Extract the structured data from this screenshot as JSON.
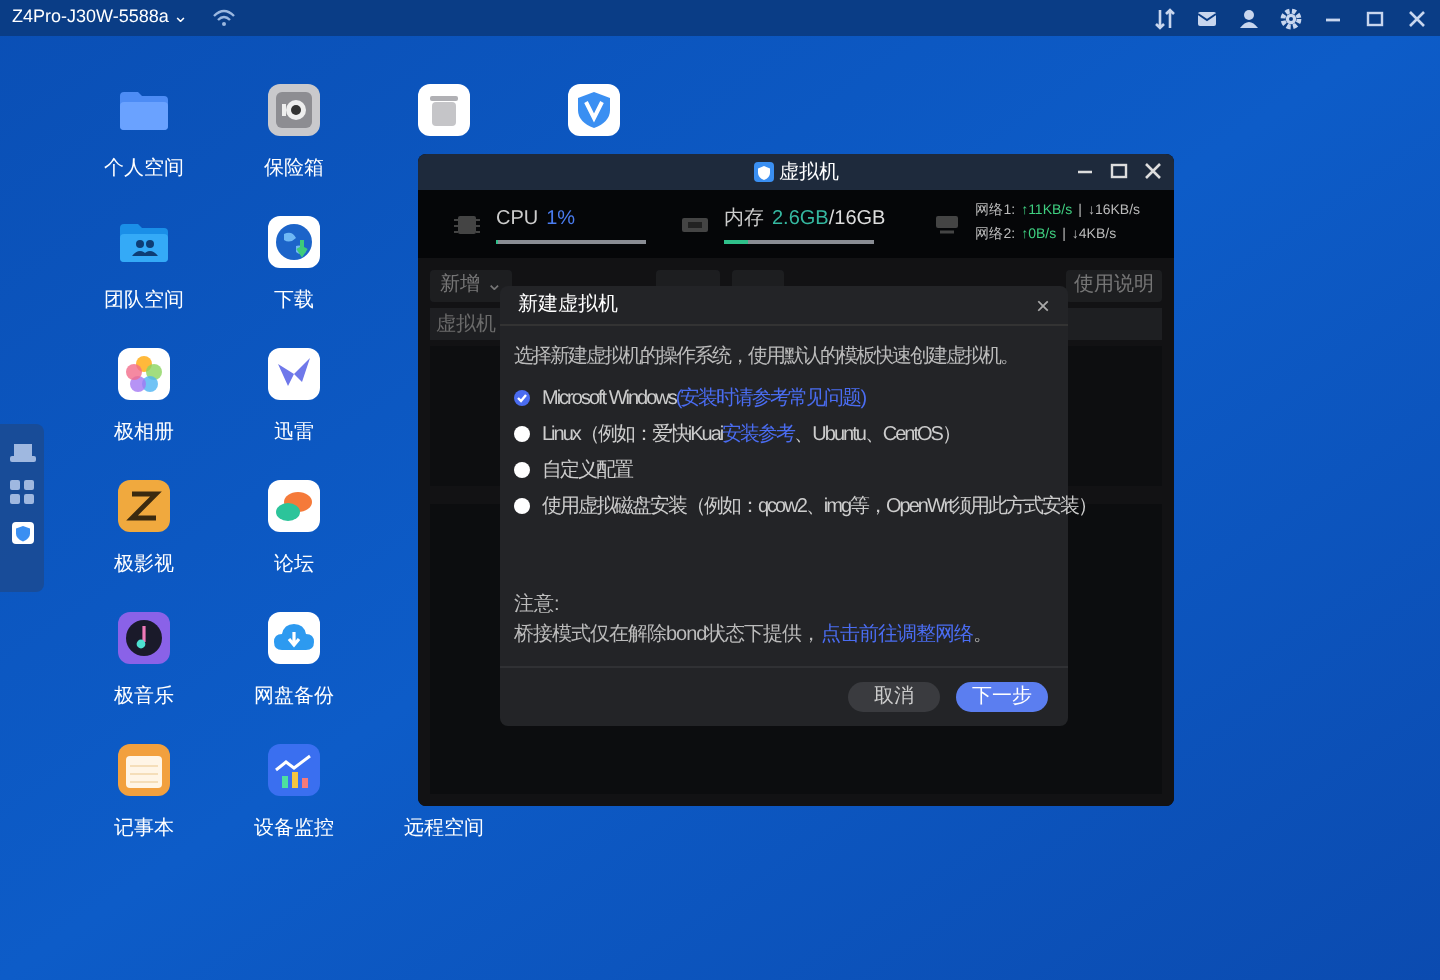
{
  "top_bar": {
    "device": "Z4Pro-J30W-5588a",
    "caret": "⌄"
  },
  "desktop_apps": [
    {
      "kind": "folder",
      "label": "个人空间"
    },
    {
      "kind": "safe",
      "label": "保险箱"
    },
    {
      "kind": "trash"
    },
    {
      "kind": "shield"
    },
    {
      "kind": "team",
      "label": "团队空间"
    },
    {
      "kind": "globe",
      "label": "下载"
    },
    {
      "kind": "photos",
      "label": "极相册"
    },
    {
      "kind": "bird",
      "label": "迅雷"
    },
    {
      "kind": "film",
      "label": "极影视"
    },
    {
      "kind": "chat",
      "label": "论坛"
    },
    {
      "kind": "music",
      "label": "极音乐"
    },
    {
      "kind": "cloud",
      "label": "网盘备份"
    },
    {
      "kind": "notes",
      "label": "记事本"
    },
    {
      "kind": "chart",
      "label": "设备监控"
    },
    {
      "kind": "hidden",
      "label": "远程空间"
    }
  ],
  "window": {
    "title": "虚拟机",
    "cpu": {
      "label": "CPU",
      "value": "1%",
      "level": 0.01
    },
    "memory": {
      "label": "内存",
      "value": "2.6GB",
      "total": "/16GB",
      "level": 0.16
    },
    "network": [
      {
        "label": "网络1:",
        "up": "↑11KB/s",
        "sep": "|",
        "down": "↓16KB/s"
      },
      {
        "label": "网络2:",
        "up": "↑0B/s",
        "sep": "|",
        "down": "↓4KB/s"
      }
    ],
    "toolbar": {
      "add": "新增 ⌄",
      "help": "使用说明"
    },
    "table_header": "虚拟机"
  },
  "dialog": {
    "title": "新建虚拟机",
    "close": "×",
    "description": "选择新建虚拟机的操作系统，使用默认的模板快速创建虚拟机。",
    "options": [
      {
        "text": "Microsoft Windows",
        "link": "(安装时请参考常见问题)",
        "selected": true
      },
      {
        "text": "Linux（例如：爱快iKuai",
        "link": "安装参考",
        "after": "、Ubuntu、CentOS）",
        "selected": false
      },
      {
        "text": "自定义配置",
        "selected": false
      },
      {
        "text": "使用虚拟磁盘安装（例如：qcow2、img等，OpenWrt须用此方式安装）",
        "selected": false
      }
    ],
    "note_title": "注意:",
    "note_text": "桥接模式仅在解除bond状态下提供，",
    "note_link": "点击前往调整网络",
    "note_end": "。",
    "buttons": [
      {
        "kind": "secondary",
        "label": "取消"
      },
      {
        "kind": "primary",
        "label": "下一步"
      }
    ]
  }
}
